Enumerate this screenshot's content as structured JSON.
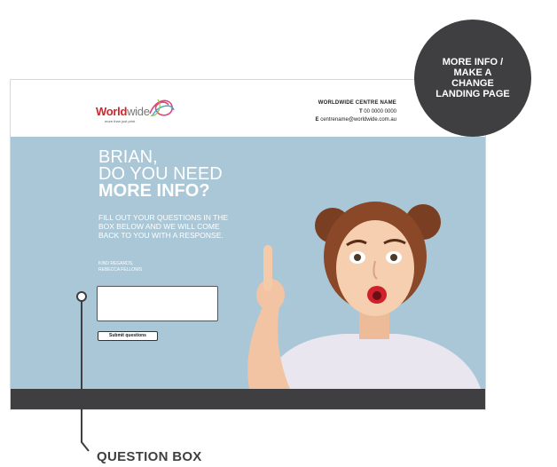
{
  "header": {
    "logo": {
      "word_bold": "World",
      "word_light": "wide",
      "tagline": "more than just print"
    },
    "centre_name": "WORLDWIDE CENTRE NAME",
    "phone_label": "T",
    "phone": "00 0000 0000",
    "email_label": "E",
    "email": "centrename@worldwide.com.au"
  },
  "hero": {
    "title_line1": "BRIAN,",
    "title_line2": "DO YOU NEED",
    "title_line3": "MORE INFO?",
    "body": "FILL OUT YOUR QUESTIONS IN THE BOX BELOW AND WE WILL COME BACK TO YOU WITH A RESPONSE.",
    "regards_line1": "KIND REGARDS,",
    "regards_line2": "REBECCA FELLOWS",
    "question_input_value": "",
    "submit_label": "Submit questions"
  },
  "badge": {
    "line1": "MORE INFO /",
    "line2": "MAKE A",
    "line3": "CHANGE",
    "line4": "LANDING PAGE"
  },
  "callout_label": "QUESTION BOX",
  "colors": {
    "hero_bg": "#a9c7d7",
    "dark": "#3f3f41",
    "brand_red": "#d3252a"
  }
}
